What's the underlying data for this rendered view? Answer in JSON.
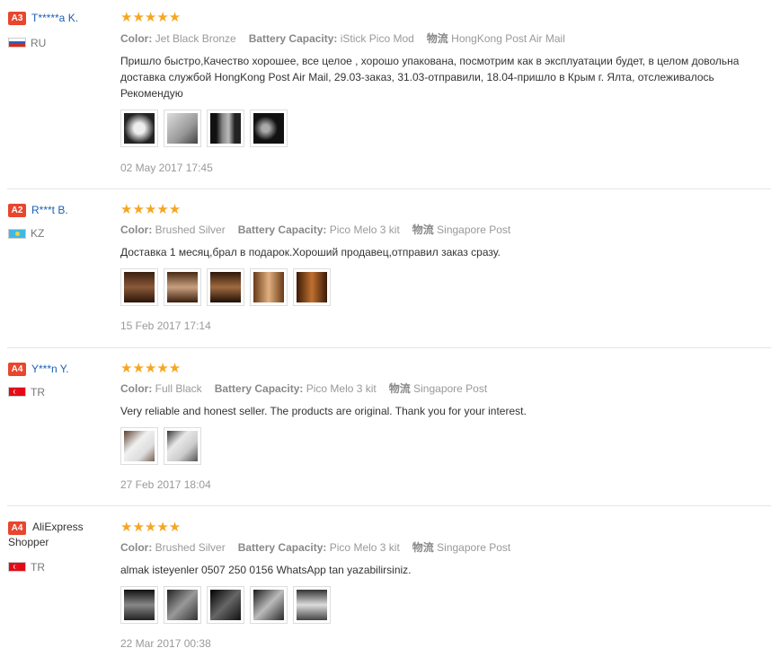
{
  "reviews": [
    {
      "badge": "A3",
      "user": "T*****a K.",
      "country": "RU",
      "stars": "★★★★★",
      "color_label": "Color:",
      "color": "Jet Black Bronze",
      "battery_label": "Battery Capacity:",
      "battery": "iStick Pico Mod",
      "ship_label": "物流",
      "ship": "HongKong Post Air Mail",
      "text": "Пришло быстро,Качество хорошее, все целое , хорошо упакована, посмотрим как в эксплуатации будет, в целом довольна доставка службой HongKong Post Air Mail, 29.03-заказ, 31.03-отправили, 18.04-пришло в Крым г. Ялта, отслеживалось Рекомендую",
      "date": "02 May 2017 17:45"
    },
    {
      "badge": "A2",
      "user": "R***t B.",
      "country": "KZ",
      "stars": "★★★★★",
      "color_label": "Color:",
      "color": "Brushed Silver",
      "battery_label": "Battery Capacity:",
      "battery": "Pico Melo 3 kit",
      "ship_label": "物流",
      "ship": "Singapore Post",
      "text": "Доставка 1 месяц,брал в подарок.Хороший продавец,отправил заказ сразу.",
      "date": "15 Feb 2017 17:14"
    },
    {
      "badge": "A4",
      "user": "Y***n Y.",
      "country": "TR",
      "stars": "★★★★★",
      "color_label": "Color:",
      "color": "Full Black",
      "battery_label": "Battery Capacity:",
      "battery": "Pico Melo 3 kit",
      "ship_label": "物流",
      "ship": "Singapore Post",
      "text": "Very reliable and honest seller. The products are original. Thank you for your interest.",
      "date": "27 Feb 2017 18:04"
    },
    {
      "badge": "A4",
      "user": "AliExpress Shopper",
      "country": "TR",
      "stars": "★★★★★",
      "color_label": "Color:",
      "color": "Brushed Silver",
      "battery_label": "Battery Capacity:",
      "battery": "Pico Melo 3 kit",
      "ship_label": "物流",
      "ship": "Singapore Post",
      "text": "almak isteyenler 0507 250 0156 WhatsApp tan yazabilirsiniz.",
      "date": "22 Mar 2017 00:38"
    }
  ],
  "colors": {
    "badge": "#e8462d",
    "star": "#f5a623",
    "username": "#1a5fb4"
  }
}
